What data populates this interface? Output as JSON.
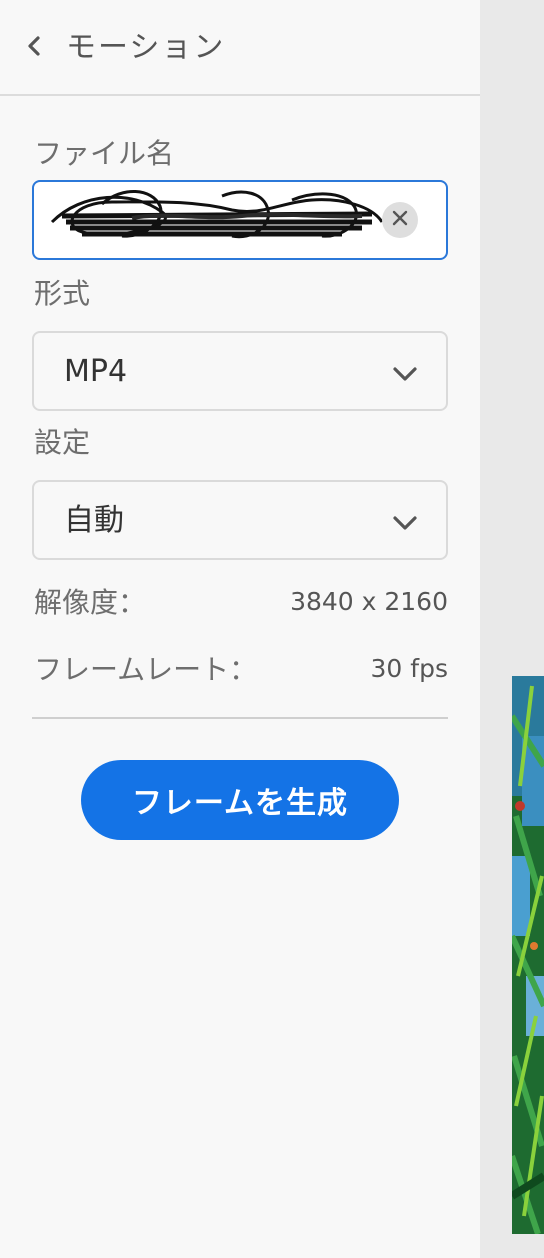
{
  "header": {
    "back_icon": "chevron-left-icon",
    "title": "モーション"
  },
  "form": {
    "filename_label": "ファイル名",
    "filename_value": "",
    "clear_icon": "close-icon",
    "format_label": "形式",
    "format_value": "MP4",
    "settings_label": "設定",
    "settings_value": "自動",
    "dropdown_icon": "chevron-down-icon"
  },
  "info": {
    "resolution_label": "解像度：",
    "resolution_value": "3840 x 2160",
    "framerate_label": "フレームレート：",
    "framerate_value": "30 fps"
  },
  "actions": {
    "generate_label": "フレームを生成"
  },
  "colors": {
    "accent": "#1473e6",
    "focus_border": "#2b78d9",
    "panel_bg": "#f8f8f8"
  }
}
